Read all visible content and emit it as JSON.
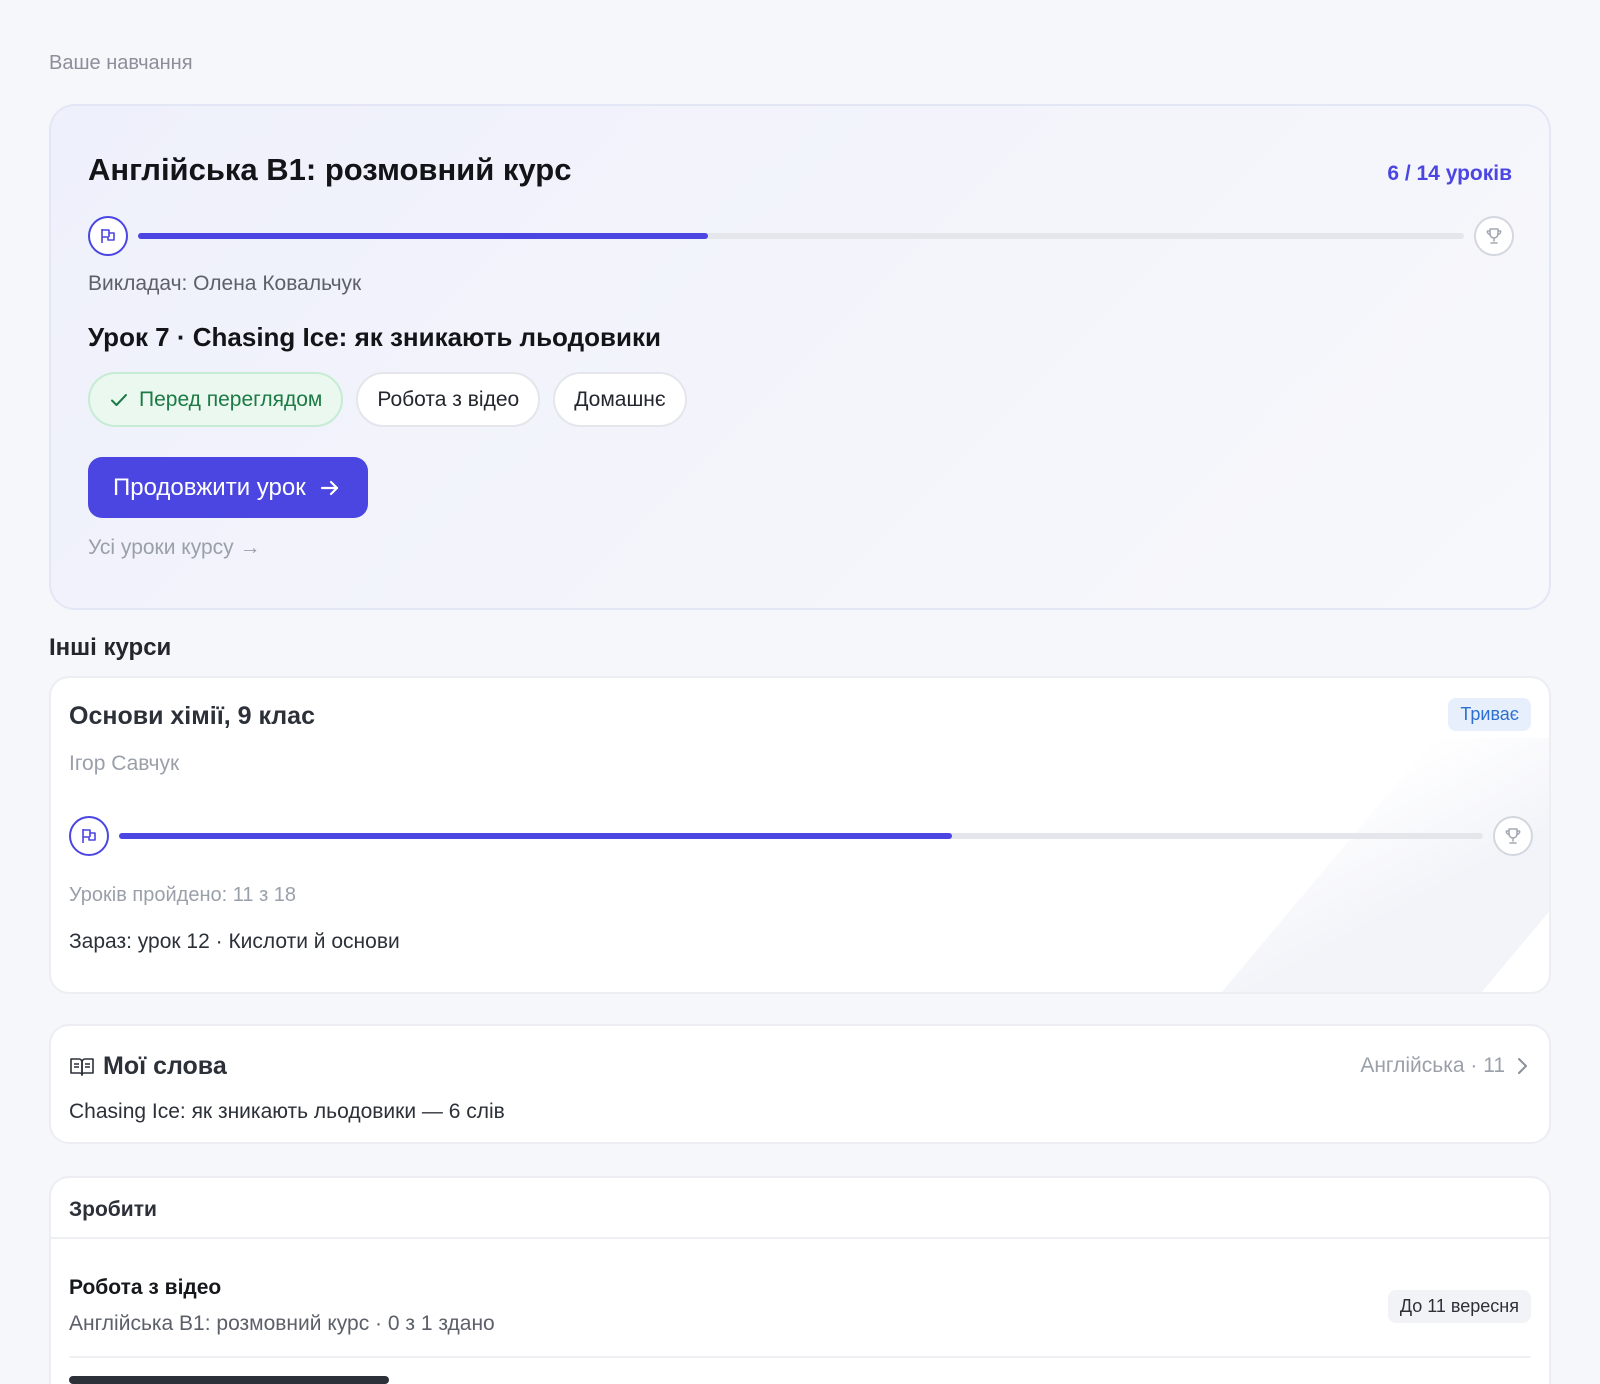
{
  "section_caption": "Ваше навчання",
  "hero": {
    "title": "Англійська B1: розмовний курс",
    "count": "6 / 14 уроків",
    "progress": 0.43,
    "teacher": "Викладач: Олена Ковальчук",
    "lesson": "Урок 7 · Chasing Ice: як зникають льодовики",
    "chips": [
      "Перед переглядом",
      "Робота з відео",
      "Домашнє"
    ],
    "continue_label": "Продовжити урок",
    "all_lessons": "Усі уроки курсу →",
    "accent": "#4b46e1"
  },
  "other_heading": "Інші курси",
  "course": {
    "title": "Основи хімії, 9 клас",
    "status": "Триває",
    "teacher": "Ігор Савчук",
    "progress": 0.611,
    "passed": "Уроків пройдено: 11 з 18",
    "current": "Зараз: урок 12 · Кислоти й основи"
  },
  "words": {
    "title": "Мої слова",
    "meta": "Англійська · 11",
    "subtitle": "Chasing Ice: як зникають льодовики — 6 слів"
  },
  "todo": {
    "heading": "Зробити",
    "items": [
      {
        "title": "Робота з відео",
        "subtitle": "Англійська B1: розмовний курс · 0 з 1 здано",
        "due": "До 11 вересня"
      }
    ]
  },
  "icons": {
    "start": "flag-icon",
    "finish": "trophy-icon",
    "check": "check-icon",
    "arrow": "arrow-right-icon",
    "book": "book-open-icon",
    "chevron": "chevron-right-icon"
  }
}
